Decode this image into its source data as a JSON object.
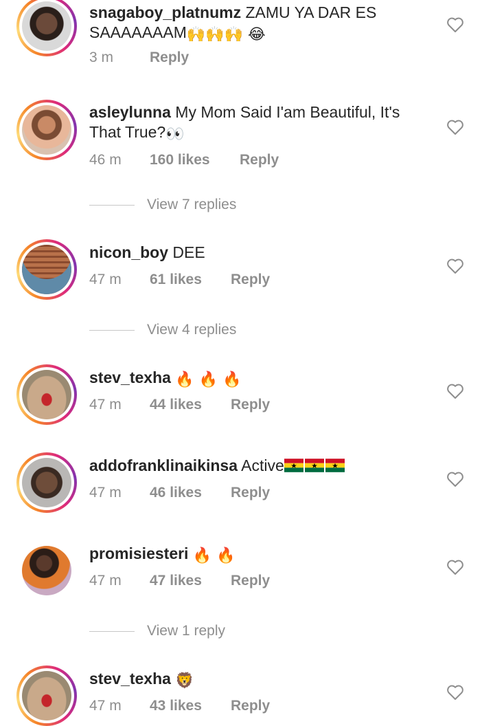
{
  "comments": [
    {
      "username": "snagaboy_platnumz",
      "text": "ZAMU YA DAR ES SAAAAAAAM",
      "emoji": "🙌🙌🙌 😂",
      "time": "3 m",
      "likes": "",
      "reply": "Reply"
    },
    {
      "username": "asleylunna",
      "text": "My Mom Said I'am Beautiful, It's That True?",
      "emoji": "👀",
      "time": "46 m",
      "likes": "160 likes",
      "reply": "Reply",
      "view_replies": "View 7 replies"
    },
    {
      "username": "nicon_boy",
      "text": "DEE",
      "emoji": "",
      "time": "47 m",
      "likes": "61 likes",
      "reply": "Reply",
      "view_replies": "View 4 replies"
    },
    {
      "username": "stev_texha",
      "text": "",
      "emoji": "🔥 🔥 🔥",
      "time": "47 m",
      "likes": "44 likes",
      "reply": "Reply"
    },
    {
      "username": "addofranklinaikinsa",
      "text": "Active",
      "emoji": "",
      "flags": 3,
      "time": "47 m",
      "likes": "46 likes",
      "reply": "Reply"
    },
    {
      "username": "promisiesteri",
      "text": "",
      "emoji": "🔥 🔥",
      "time": "47 m",
      "likes": "47 likes",
      "reply": "Reply",
      "view_replies": "View 1 reply"
    },
    {
      "username": "stev_texha",
      "text": "",
      "emoji": "🦁",
      "time": "47 m",
      "likes": "43 likes",
      "reply": "Reply"
    }
  ],
  "colors": {
    "text": "#262626",
    "muted": "#8e8e8e",
    "divider": "#c7c7c7"
  },
  "icons": {
    "like": "heart-outline-icon"
  }
}
